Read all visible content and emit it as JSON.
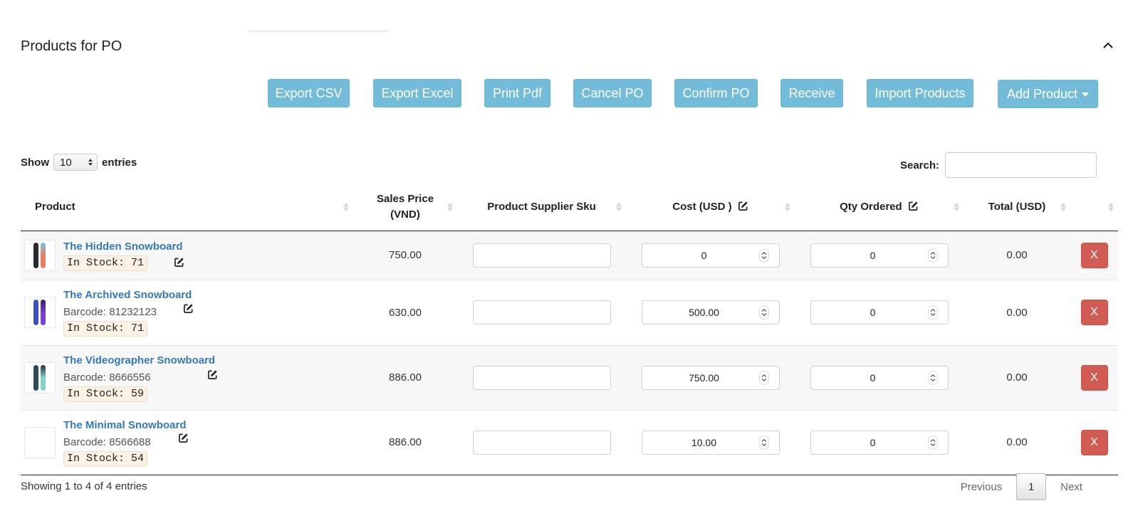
{
  "panel": {
    "title": "Products for PO",
    "collapse_icon": "chevron-up-icon"
  },
  "toolbar": {
    "buttons": [
      {
        "label": "Export CSV"
      },
      {
        "label": "Export Excel"
      },
      {
        "label": "Print Pdf"
      },
      {
        "label": "Cancel PO"
      },
      {
        "label": "Confirm PO"
      },
      {
        "label": "Receive"
      },
      {
        "label": "Import Products"
      },
      {
        "label": "Add Product",
        "icon": "caret-down-icon"
      }
    ]
  },
  "table_controls": {
    "show_label": "Show",
    "page_length": "10",
    "entries_label": "entries",
    "search_label": "Search:",
    "search_value": ""
  },
  "columns": [
    {
      "label": "Product"
    },
    {
      "label": "Sales Price (VND)"
    },
    {
      "label": "Product Supplier Sku"
    },
    {
      "label": "Cost (USD )",
      "icon": "edit-icon"
    },
    {
      "label": "Qty Ordered",
      "icon": "edit-icon"
    },
    {
      "label": "Total (USD)"
    },
    {
      "label": ""
    }
  ],
  "rows": [
    {
      "name": "The Hidden Snowboard",
      "barcode": "",
      "stock": "In Stock: 71",
      "sales_price": "750.00",
      "supplier_sku": "",
      "cost": "0",
      "qty": "0",
      "total": "0.00",
      "remove_label": "X",
      "thumb_colors": [
        "#2b2b2b",
        "#f07c5e",
        "#6fc9e6"
      ]
    },
    {
      "name": "The Archived Snowboard",
      "barcode": "Barcode: 81232123",
      "stock": "In Stock: 71",
      "sales_price": "630.00",
      "supplier_sku": "",
      "cost": "500.00",
      "qty": "0",
      "total": "0.00",
      "remove_label": "X",
      "thumb_colors": [
        "#3a4fc4",
        "#7b3fd6",
        "#2a1f6e"
      ]
    },
    {
      "name": "The Videographer Snowboard",
      "barcode": "Barcode: 8666556",
      "stock": "In Stock: 59",
      "sales_price": "886.00",
      "supplier_sku": "",
      "cost": "750.00",
      "qty": "0",
      "total": "0.00",
      "remove_label": "X",
      "thumb_colors": [
        "#2d4a55",
        "#7fd3cc",
        "#1f3038"
      ]
    },
    {
      "name": "The Minimal Snowboard",
      "barcode": "Barcode: 8566688",
      "stock": "In Stock: 54",
      "sales_price": "886.00",
      "supplier_sku": "",
      "cost": "10.00",
      "qty": "0",
      "total": "0.00",
      "remove_label": "X",
      "thumb_colors": []
    }
  ],
  "footer": {
    "info": "Showing 1 to 4 of 4 entries",
    "previous": "Previous",
    "current_page": "1",
    "next": "Next"
  },
  "colors": {
    "info_button": "#72bcd9",
    "danger_button": "#d25c54",
    "link": "#337ab7",
    "stock_badge_bg": "#fcf2e4"
  }
}
